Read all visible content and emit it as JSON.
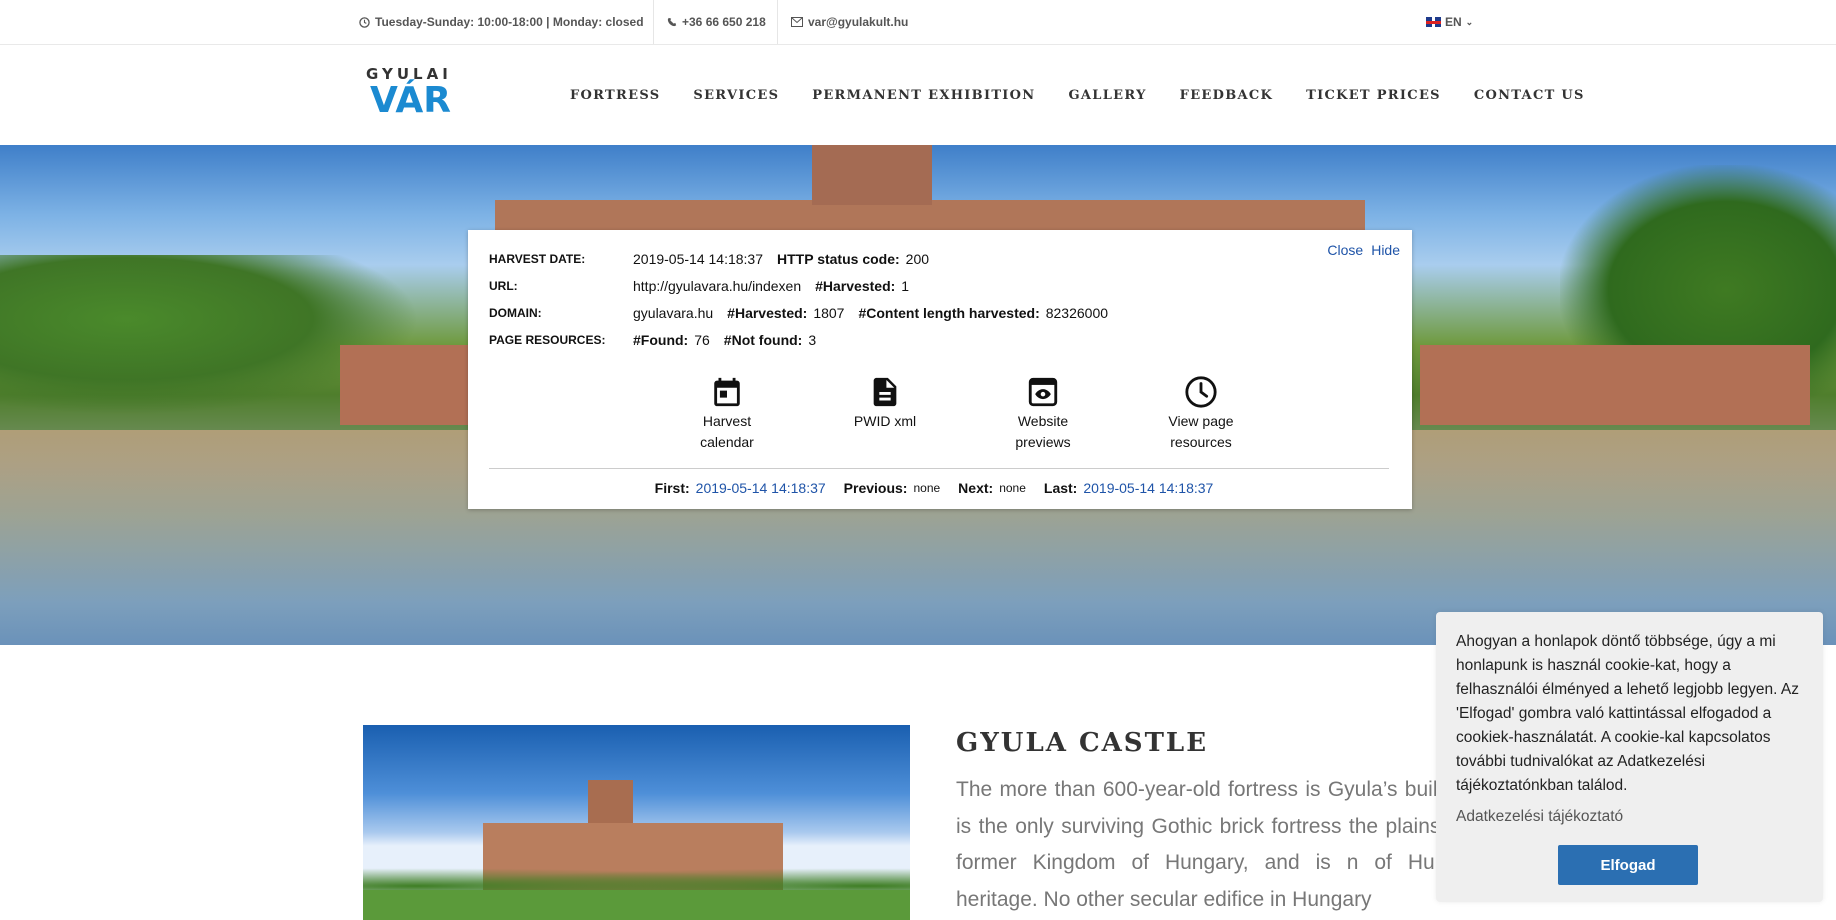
{
  "topbar": {
    "hours": "Tuesday-Sunday: 10:00-18:00 | Monday: closed",
    "phone": "+36 66 650 218",
    "email": "var@gyulakult.hu",
    "language": "EN"
  },
  "header": {
    "logo_top": "GYULAI",
    "logo_bottom": "VÁR",
    "nav": [
      "FORTRESS",
      "SERVICES",
      "PERMANENT EXHIBITION",
      "GALLERY",
      "FEEDBACK",
      "TICKET PRICES",
      "CONTACT US"
    ]
  },
  "archive_panel": {
    "close_label": "Close",
    "hide_label": "Hide",
    "harvest_date_label": "HARVEST DATE:",
    "harvest_date": "2019-05-14 14:18:37",
    "http_status_label": "HTTP status code:",
    "http_status": "200",
    "url_label": "URL:",
    "url": "http://gyulavara.hu/indexen",
    "url_harvested_label": "#Harvested:",
    "url_harvested": "1",
    "domain_label": "DOMAIN:",
    "domain": "gyulavara.hu",
    "domain_harvested_label": "#Harvested:",
    "domain_harvested": "1807",
    "content_length_label": "#Content length harvested:",
    "content_length": "82326000",
    "resources_label": "PAGE RESOURCES:",
    "found_label": "#Found:",
    "found": "76",
    "not_found_label": "#Not found:",
    "not_found": "3",
    "actions": [
      {
        "label": "Harvest calendar",
        "icon": "calendar-icon"
      },
      {
        "label": "PWID xml",
        "icon": "document-icon"
      },
      {
        "label": "Website previews",
        "icon": "eye-icon"
      },
      {
        "label": "View page resources",
        "icon": "clock-icon"
      }
    ],
    "first_label": "First:",
    "first": "2019-05-14 14:18:37",
    "previous_label": "Previous:",
    "previous": "none",
    "next_label": "Next:",
    "next": "none",
    "last_label": "Last:",
    "last": "2019-05-14 14:18:37"
  },
  "content": {
    "title": "GYULA CASTLE",
    "text": "The more than 600-year-old fortress is Gyula’s building. It is the only surviving Gothic brick fortress the plains of the former Kingdom of Hungary, and is n of Hungary’s heritage. No other secular edifice in Hungary"
  },
  "cookie": {
    "message": "Ahogyan a honlapok döntő többsége, úgy a mi honlapunk is használ cookie-kat, hogy a felhasználói élményed a lehető legjobb legyen. Az 'Elfogad' gombra való kattintással elfogadod a cookiek-használatát. A cookie-kal kapcsolatos további tudnivalókat az Adatkezelési tájékoztatónkban találod.",
    "more_link": "Adatkezelési tájékoztató",
    "accept": "Elfogad"
  },
  "colors": {
    "brand_blue": "#1b8ad1",
    "link_blue": "#1f54a8",
    "accept_button": "#2b6fb2"
  }
}
